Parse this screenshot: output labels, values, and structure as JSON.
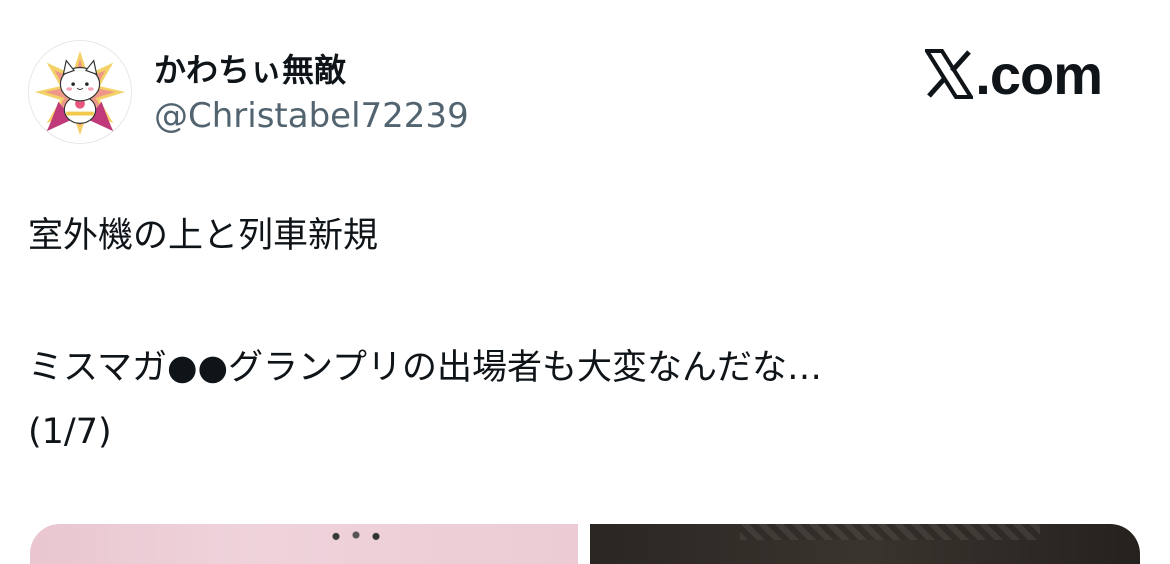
{
  "author": {
    "display_name": "かわちぃ無敵",
    "handle": "@Christabel72239",
    "avatar_icon": "cat-superhero-avatar-icon"
  },
  "brand": {
    "label": ".com",
    "logo_icon": "x-logo-icon"
  },
  "tweet": {
    "line1": "室外機の上と列車新規",
    "line2": "ミスマガ●●グランプリの出場者も大変なんだな…",
    "line3": "(1/7)"
  },
  "media": {
    "items": [
      {
        "icon": "photo-thumbnail-1"
      },
      {
        "icon": "photo-thumbnail-2"
      }
    ]
  },
  "colors": {
    "text_primary": "#0f1419",
    "text_secondary": "#536471",
    "background": "#ffffff"
  }
}
